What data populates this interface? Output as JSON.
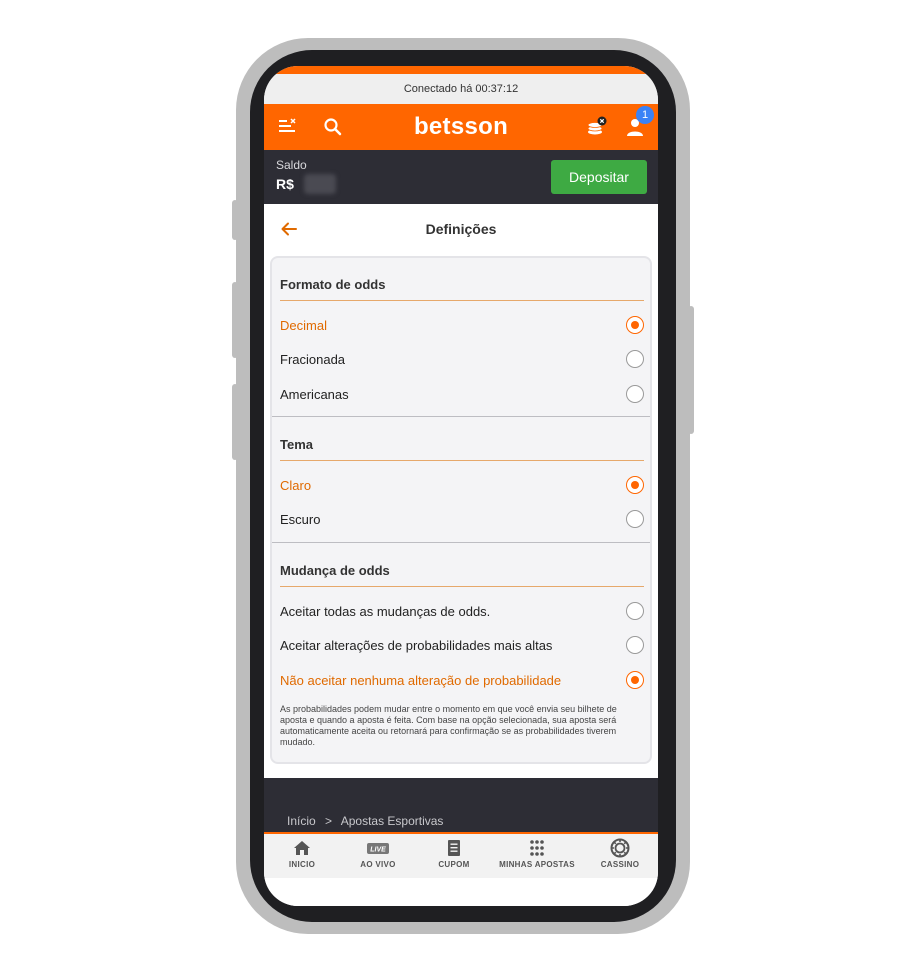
{
  "status": {
    "connected_text": "Conectado há 00:37:12"
  },
  "header": {
    "logo": "betsson",
    "notification_count": "1",
    "colors": {
      "brand": "#ff6600"
    }
  },
  "balance": {
    "label": "Saldo",
    "currency": "R$",
    "deposit_label": "Depositar"
  },
  "page": {
    "title": "Definições"
  },
  "settings": {
    "odds_format": {
      "title": "Formato de odds",
      "options": [
        {
          "label": "Decimal",
          "selected": true
        },
        {
          "label": "Fracionada",
          "selected": false
        },
        {
          "label": "Americanas",
          "selected": false
        }
      ]
    },
    "theme": {
      "title": "Tema",
      "options": [
        {
          "label": "Claro",
          "selected": true
        },
        {
          "label": "Escuro",
          "selected": false
        }
      ]
    },
    "odds_change": {
      "title": "Mudança de odds",
      "options": [
        {
          "label": "Aceitar todas as mudanças de odds.",
          "selected": false
        },
        {
          "label": "Aceitar alterações de probabilidades mais altas",
          "selected": false
        },
        {
          "label": "Não aceitar nenhuma alteração de probabilidade",
          "selected": true
        }
      ],
      "note": "As probabilidades podem mudar entre o momento em que você envia seu bilhete de aposta e quando a aposta é feita. Com base na opção selecionada, sua aposta será automaticamente aceita ou retornará para confirmação se as probabilidades tiverem mudado."
    }
  },
  "breadcrumb": {
    "home": "Início",
    "separator": ">",
    "current": "Apostas Esportivas"
  },
  "bottom_nav": {
    "items": [
      {
        "label": "INICIO",
        "icon": "home-icon"
      },
      {
        "label": "AO VIVO",
        "icon": "live-icon",
        "badge": "LIVE"
      },
      {
        "label": "CUPOM",
        "icon": "coupon-icon"
      },
      {
        "label": "MINHAS APOSTAS",
        "icon": "grid-icon"
      },
      {
        "label": "CASSINO",
        "icon": "casino-chip-icon"
      }
    ]
  }
}
